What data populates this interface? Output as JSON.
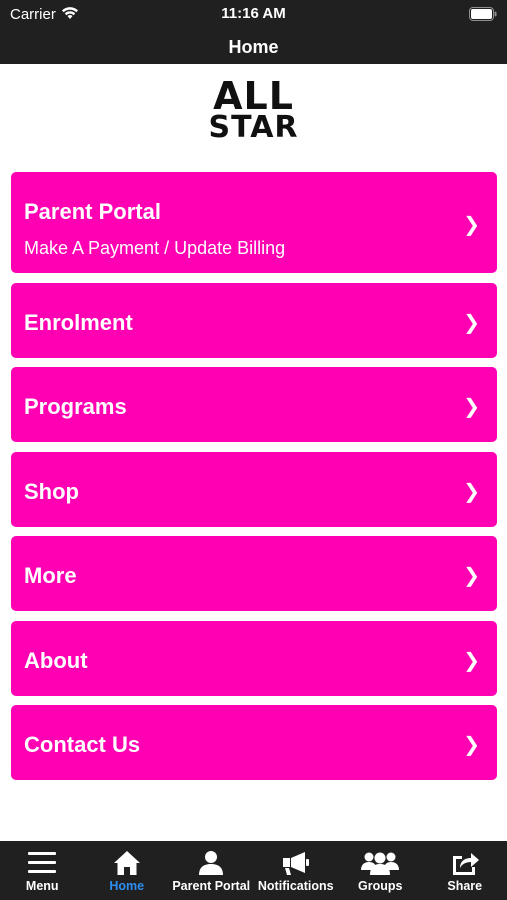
{
  "status_bar": {
    "carrier": "Carrier",
    "time": "11:16 AM"
  },
  "nav": {
    "title": "Home"
  },
  "logo": {
    "line1": "ALL",
    "line2": "STAR"
  },
  "menu": {
    "items": [
      {
        "label": "Parent Portal",
        "sublabel": "Make A Payment / Update Billing",
        "chevron": "❯"
      },
      {
        "label": "Enrolment",
        "chevron": "❯"
      },
      {
        "label": "Programs",
        "chevron": "❯"
      },
      {
        "label": "Shop",
        "chevron": "❯"
      },
      {
        "label": "More",
        "chevron": "❯"
      },
      {
        "label": "About",
        "chevron": "❯"
      },
      {
        "label": "Contact Us",
        "chevron": "❯"
      }
    ]
  },
  "tabbar": {
    "tabs": [
      {
        "label": "Menu",
        "icon": "hamburger-icon"
      },
      {
        "label": "Home",
        "icon": "home-icon",
        "active": true
      },
      {
        "label": "Parent Portal",
        "icon": "person-icon"
      },
      {
        "label": "Notifications",
        "icon": "megaphone-icon"
      },
      {
        "label": "Groups",
        "icon": "group-icon"
      },
      {
        "label": "Share",
        "icon": "share-icon"
      }
    ]
  },
  "colors": {
    "accent": "#ff00b3",
    "bar": "#202020",
    "active_tab": "#2d8ef0"
  }
}
